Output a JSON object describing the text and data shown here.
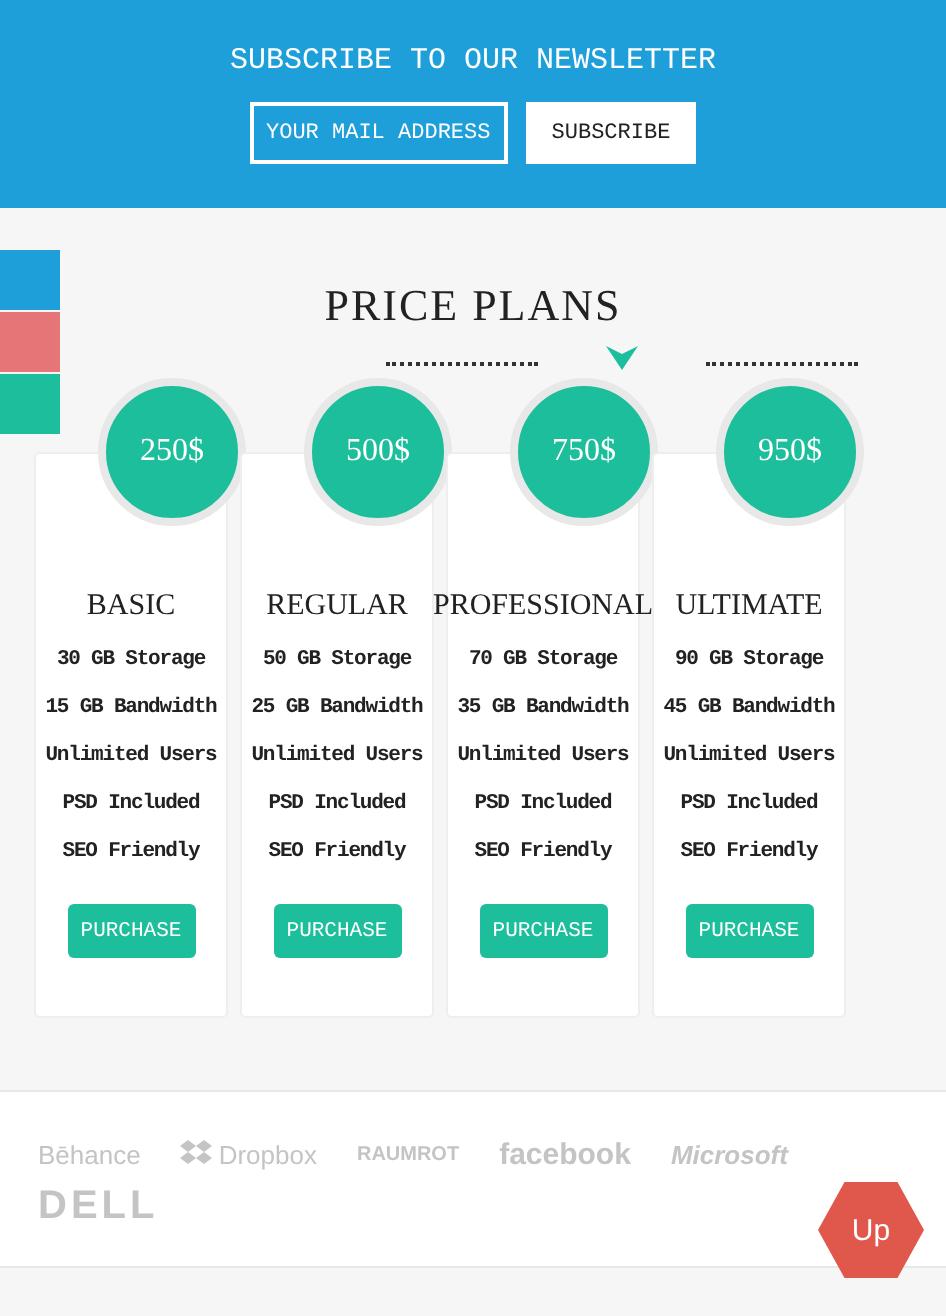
{
  "newsletter": {
    "title": "SUBSCRIBE TO OUR NEWSLETTER",
    "placeholder": "YOUR MAIL ADDRESS",
    "button": "SUBSCRIBE"
  },
  "color_swatches": [
    {
      "color": "#1e9fda"
    },
    {
      "color": "#e57576"
    },
    {
      "color": "#1dbe9b"
    }
  ],
  "pricing": {
    "title": "PRICE PLANS",
    "plans": [
      {
        "price": "250$",
        "name": "BASIC",
        "features": [
          "30 GB Storage",
          "15 GB Bandwidth",
          "Unlimited Users",
          "PSD Included",
          "SEO Friendly"
        ],
        "button": "PURCHASE"
      },
      {
        "price": "500$",
        "name": "REGULAR",
        "features": [
          "50 GB Storage",
          "25 GB Bandwidth",
          "Unlimited Users",
          "PSD Included",
          "SEO Friendly"
        ],
        "button": "PURCHASE"
      },
      {
        "price": "750$",
        "name": "PROFESSIONAL",
        "features": [
          "70 GB Storage",
          "35 GB Bandwidth",
          "Unlimited Users",
          "PSD Included",
          "SEO Friendly"
        ],
        "button": "PURCHASE"
      },
      {
        "price": "950$",
        "name": "ULTIMATE",
        "features": [
          "90 GB Storage",
          "45 GB Bandwidth",
          "Unlimited Users",
          "PSD Included",
          "SEO Friendly"
        ],
        "button": "PURCHASE"
      }
    ]
  },
  "partners": [
    {
      "name": "Bēhance",
      "kind": "plain"
    },
    {
      "name": "Dropbox",
      "kind": "dropbox"
    },
    {
      "name": "RAUMROT",
      "kind": "raumrot"
    },
    {
      "name": "facebook",
      "kind": "bold"
    },
    {
      "name": "Microsoft",
      "kind": "italic"
    },
    {
      "name": "DELL",
      "kind": "heavy"
    }
  ],
  "up_button": "Up"
}
